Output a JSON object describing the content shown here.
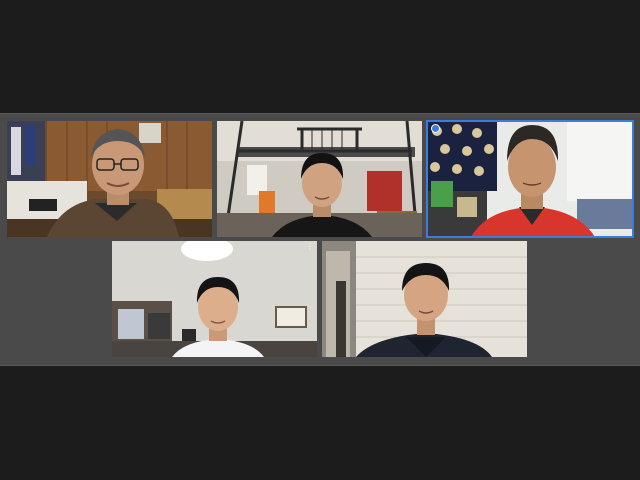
{
  "app": {
    "view_mode": "gallery",
    "active_speaker_index": 2
  },
  "participants": [
    {
      "name": "",
      "video": "man-with-glasses-wooden-room"
    },
    {
      "name": "",
      "video": "young-man-under-loft-bed"
    },
    {
      "name": "",
      "video": "older-man-red-jacket-polka-dot-wall"
    },
    {
      "name": "",
      "video": "young-man-bright-room"
    },
    {
      "name": "",
      "video": "young-man-dark-hoodie-wall-panels"
    }
  ],
  "colors": {
    "background": "#1c1c1c",
    "stage": "#4a4a4a",
    "active_border": "#3b7ddd"
  }
}
